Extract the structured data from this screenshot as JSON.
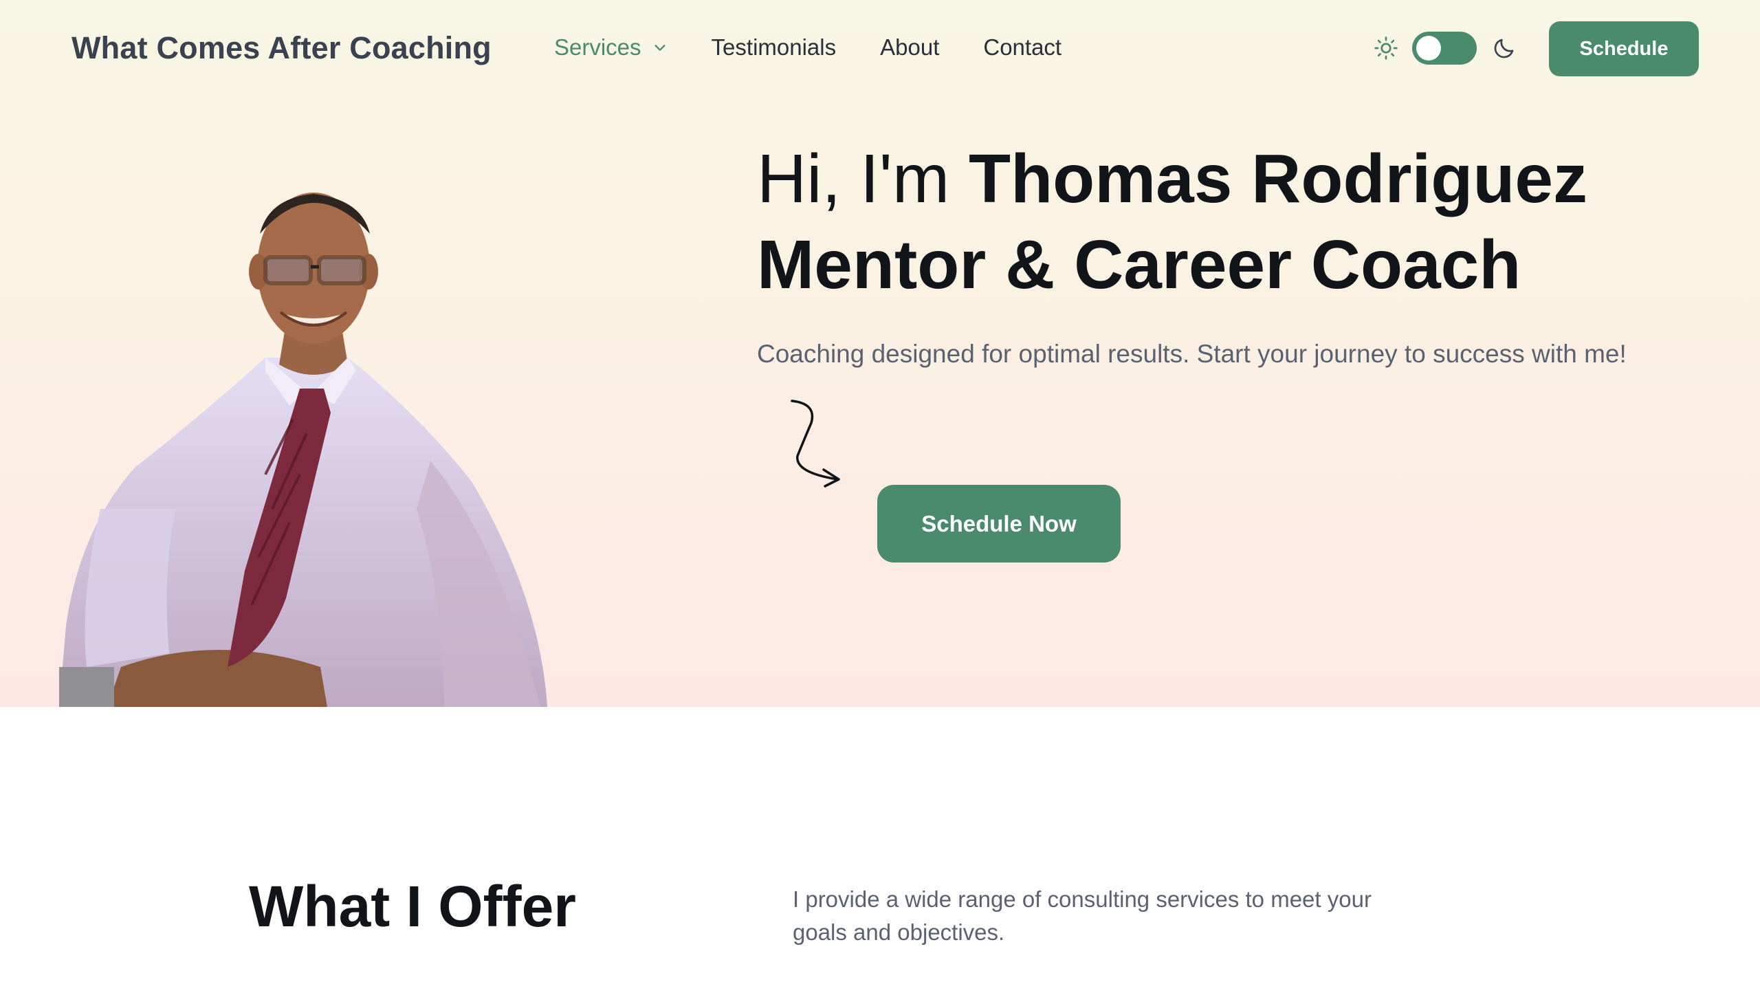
{
  "brand": "What Comes After Coaching",
  "nav": {
    "items": [
      {
        "label": "Services",
        "active": true,
        "has_dropdown": true
      },
      {
        "label": "Testimonials"
      },
      {
        "label": "About"
      },
      {
        "label": "Contact"
      }
    ]
  },
  "theme_toggle": {
    "left_icon": "sun-icon",
    "right_icon": "moon-icon",
    "state": "light"
  },
  "header_cta": "Schedule",
  "hero": {
    "greeting": "Hi, I'm",
    "name": "Thomas Rodriguez",
    "role": "Mentor & Career Coach",
    "subtitle": "Coaching designed for optimal results. Start your journey to success with me!",
    "cta": "Schedule Now"
  },
  "offer": {
    "title": "What I Offer",
    "description": "I provide a wide range of consulting services to meet your goals and objectives."
  },
  "colors": {
    "accent": "#4a8a6d",
    "text": "#111418",
    "muted": "#5a6170"
  }
}
